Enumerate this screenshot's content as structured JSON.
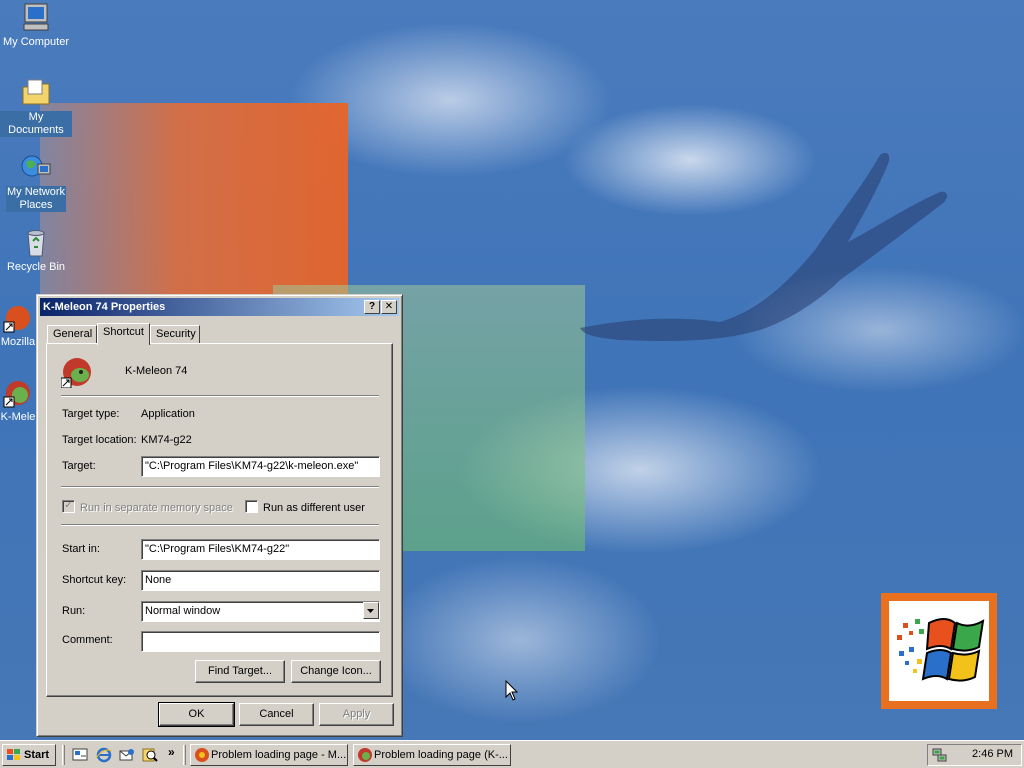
{
  "desktop": {
    "icons": [
      {
        "label": "My Computer",
        "icon": "computer-icon"
      },
      {
        "label": "My Documents",
        "icon": "folder-documents-icon"
      },
      {
        "label_line1": "My Network",
        "label_line2": "Places",
        "icon": "network-places-icon"
      },
      {
        "label": "Recycle Bin",
        "icon": "recycle-bin-icon"
      },
      {
        "label": "Mozilla",
        "icon": "mozilla-shortcut-icon"
      },
      {
        "label": "K-Mele",
        "icon": "kmeleon-shortcut-icon"
      }
    ]
  },
  "dialog": {
    "title": "K-Meleon 74 Properties",
    "help_button": "?",
    "close_button": "✕",
    "tabs": [
      {
        "label": "General",
        "active": false
      },
      {
        "label": "Shortcut",
        "active": true
      },
      {
        "label": "Security",
        "active": false
      }
    ],
    "app_name": "K-Meleon 74",
    "target_type_label": "Target type:",
    "target_type_value": "Application",
    "target_location_label": "Target location:",
    "target_location_value": "KM74-g22",
    "target_label": "Target:",
    "target_value": "\"C:\\Program Files\\KM74-g22\\k-meleon.exe\"",
    "run_separate_label": "Run in separate memory space",
    "run_separate_checked": true,
    "run_as_label": "Run as different user",
    "run_as_checked": false,
    "start_in_label": "Start in:",
    "start_in_value": "\"C:\\Program Files\\KM74-g22\"",
    "shortcut_key_label": "Shortcut key:",
    "shortcut_key_value": "None",
    "run_label": "Run:",
    "run_value": "Normal window",
    "comment_label": "Comment:",
    "comment_value": "",
    "find_target_button": "Find Target...",
    "change_icon_button": "Change Icon...",
    "ok_button": "OK",
    "cancel_button": "Cancel",
    "apply_button": "Apply"
  },
  "taskbar": {
    "start_label": "Start",
    "quick_launch": [
      "show-desktop-icon",
      "internet-explorer-icon",
      "outlook-express-icon",
      "search-icon"
    ],
    "overflow": "»",
    "tasks": [
      {
        "label": "Problem loading page - M...",
        "icon": "mozilla-icon"
      },
      {
        "label": "Problem loading page (K-...",
        "icon": "kmeleon-icon"
      }
    ],
    "clock": "2:46 PM"
  },
  "colors": {
    "desktop_blue": "#3f74b8",
    "title_active_start": "#0a246a",
    "title_active_end": "#a6caf0",
    "button_face": "#d4d0c8"
  }
}
